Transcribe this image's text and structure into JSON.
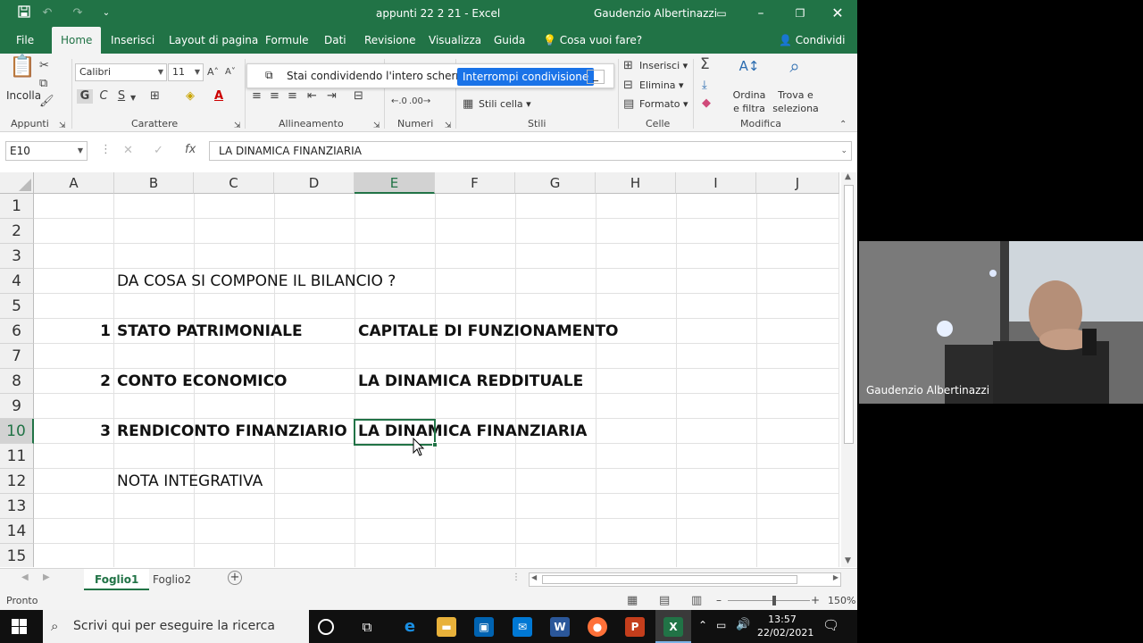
{
  "window": {
    "title": "appunti 22 2 21  -  Excel",
    "user": "Gaudenzio Albertinazzi"
  },
  "tabs": [
    "File",
    "Home",
    "Inserisci",
    "Layout di pagina",
    "Formule",
    "Dati",
    "Revisione",
    "Visualizza",
    "Guida"
  ],
  "tell_me": "Cosa vuoi fare?",
  "share": "Condividi",
  "ribbon": {
    "paste": "Incolla",
    "font_name": "Calibri",
    "font_size": "11",
    "bold": "G",
    "italic": "C",
    "underline": "S",
    "cell_styles": "Stili cella",
    "insert": "Inserisci",
    "delete": "Elimina",
    "format": "Formato",
    "sort_filter": "Ordina e filtra",
    "find_select": "Trova e seleziona",
    "groups": {
      "clipboard": "Appunti",
      "font": "Carattere",
      "alignment": "Allineamento",
      "numbers": "Numeri",
      "styles": "Stili",
      "cells": "Celle",
      "edit": "Modifica"
    }
  },
  "sharing_bar": {
    "message": "Stai condividendo l'intero schermo.",
    "stop": "Interrompi condivisione"
  },
  "formula_bar": {
    "name_box": "E10",
    "fx": "fx",
    "value": "LA DINAMICA FINANZIARIA"
  },
  "columns": [
    "A",
    "B",
    "C",
    "D",
    "E",
    "F",
    "G",
    "H",
    "I",
    "J"
  ],
  "rows": [
    "1",
    "2",
    "3",
    "4",
    "5",
    "6",
    "7",
    "8",
    "9",
    "10",
    "11",
    "12",
    "13",
    "14",
    "15"
  ],
  "cells": {
    "b4": "DA COSA SI COMPONE IL BILANCIO ?",
    "a6": "1",
    "b6": "STATO PATRIMONIALE",
    "e6": "CAPITALE DI FUNZIONAMENTO",
    "a8": "2",
    "b8": "CONTO ECONOMICO",
    "e8": "LA DINAMICA REDDITUALE",
    "a10": "3",
    "b10": "RENDICONTO FINANZIARIO",
    "e10": "LA DINAMICA FINANZIARIA",
    "b12": "NOTA INTEGRATIVA"
  },
  "sheets": [
    "Foglio1",
    "Foglio2"
  ],
  "status": {
    "ready": "Pronto",
    "zoom": "150%"
  },
  "video": {
    "participant": "Gaudenzio Albertinazzi"
  },
  "taskbar": {
    "search_placeholder": "Scrivi qui per eseguire la ricerca",
    "time": "13:57",
    "date": "22/02/2021"
  },
  "colors": {
    "excel_green": "#217346",
    "share_blue": "#1a73e8"
  }
}
